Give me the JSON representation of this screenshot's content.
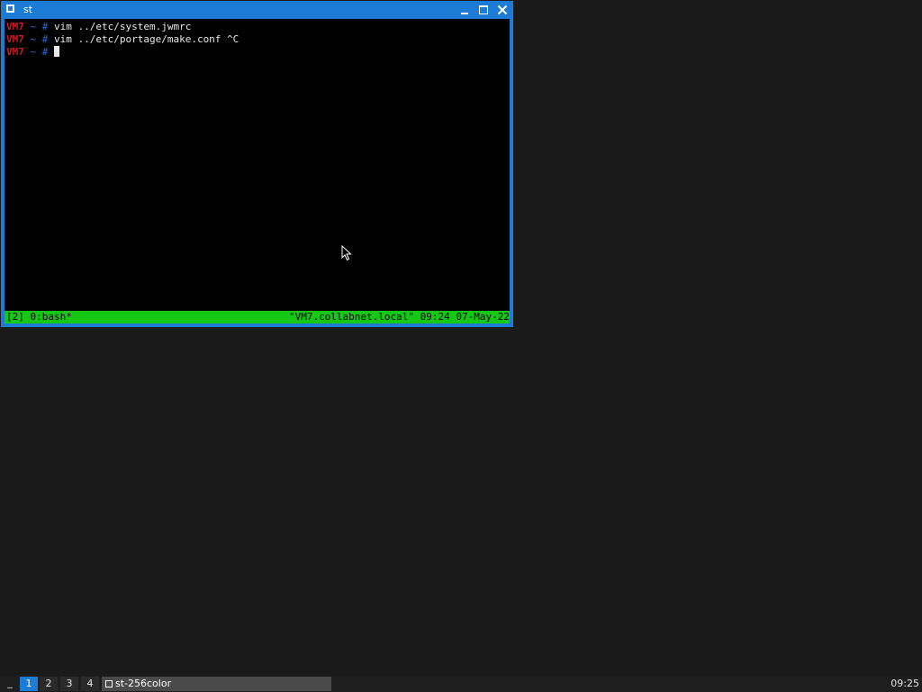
{
  "window": {
    "title": "st"
  },
  "terminal": {
    "lines": [
      {
        "host": "VM7",
        "tilde": " ~",
        "prompt": " # ",
        "command": "vim ../etc/system.jwmrc"
      },
      {
        "host": "VM7",
        "tilde": " ~",
        "prompt": " # ",
        "command": "vim ../etc/portage/make.conf ^C"
      },
      {
        "host": "VM7",
        "tilde": " ~",
        "prompt": " # ",
        "command": ""
      }
    ],
    "status_left": "[2] 0:bash*",
    "status_right": "\"VM7.collabnet.local\" 09:24 07-May-22"
  },
  "taskbar": {
    "menu_label": "_",
    "workspaces": [
      "1",
      "2",
      "3",
      "4"
    ],
    "active_workspace": "1",
    "task_label": "st-256color",
    "clock": "09:25"
  },
  "colors": {
    "titlebar": "#1c7bd4",
    "status_bar": "#14c814",
    "hostname": "#d4141a",
    "desktop": "#1a1a1a"
  }
}
